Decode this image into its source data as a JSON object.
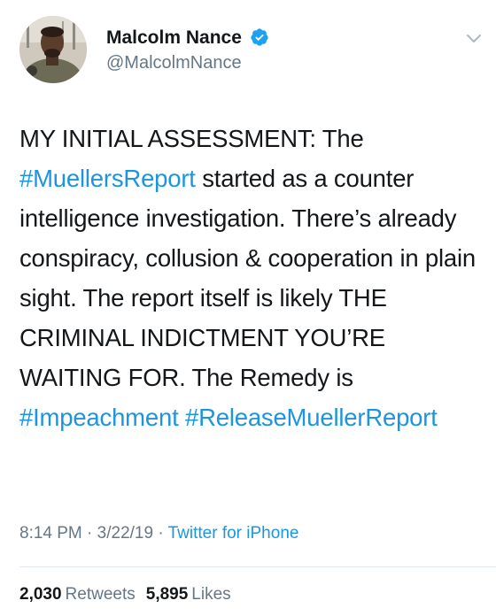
{
  "author": {
    "display_name": "Malcolm Nance",
    "handle": "@MalcolmNance",
    "verified": true
  },
  "tweet": {
    "segments": [
      {
        "text": "MY INITIAL ASSESSMENT: The ",
        "type": "text"
      },
      {
        "text": "#MuellersReport",
        "type": "hashtag"
      },
      {
        "text": " started as a counter intelligence investigation. There’s already conspiracy, collusion & cooperation in plain sight. The report itself is likely THE CRIMINAL INDICTMENT YOU’RE WAITING FOR. The Remedy is ",
        "type": "text"
      },
      {
        "text": "#Impeachment",
        "type": "hashtag"
      },
      {
        "text": " ",
        "type": "text"
      },
      {
        "text": "#ReleaseMuellerReport",
        "type": "hashtag"
      }
    ],
    "time": "8:14 PM",
    "separator": " · ",
    "date": "3/22/19",
    "source": "Twitter for iPhone"
  },
  "stats": {
    "retweets_count": "2,030",
    "retweets_label": "Retweets",
    "likes_count": "5,895",
    "likes_label": "Likes"
  },
  "colors": {
    "link": "#1b95e0",
    "verified": "#1da1f2",
    "secondary_text": "#657786",
    "primary_text": "#14171a"
  },
  "icons": {
    "verified": "verified-badge-icon",
    "menu": "chevron-down-icon"
  }
}
